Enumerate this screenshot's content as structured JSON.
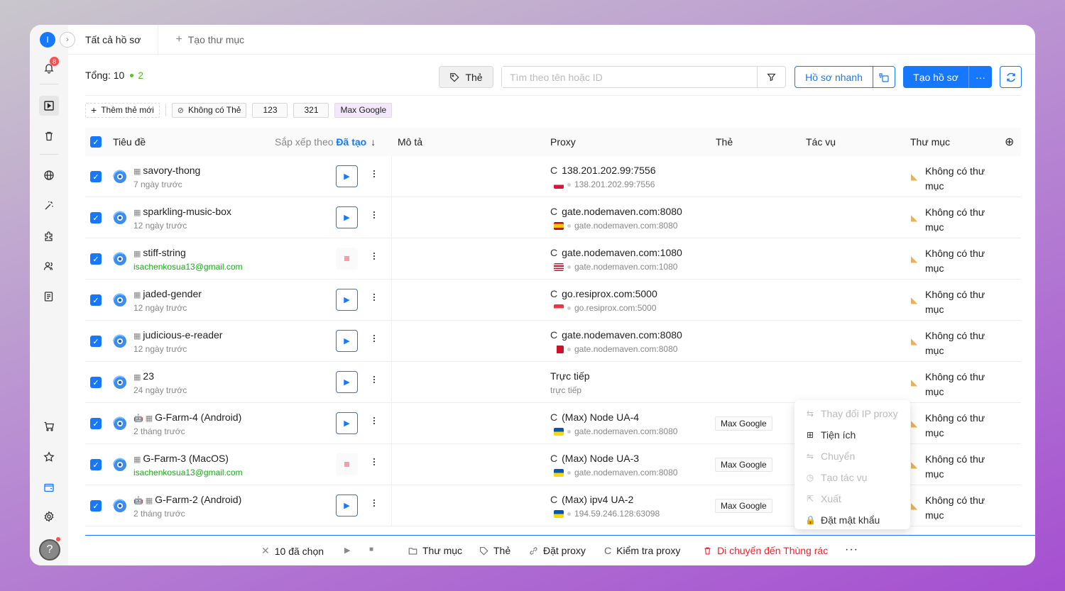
{
  "sidebar": {
    "avatar": "I",
    "expand_icon": "›",
    "notifications": "8"
  },
  "tabs": {
    "active": "Tất cả hồ sơ",
    "new_folder": "Tạo thư mục"
  },
  "toolbar": {
    "total_label": "Tổng:",
    "total": "10",
    "running": "2",
    "tag_button": "Thẻ",
    "search_placeholder": "Tìm theo tên hoặc ID",
    "quick_profile": "Hồ sơ nhanh",
    "create_profile": "Tạo hồ sơ",
    "more": "···"
  },
  "tags": {
    "add": "Thêm thẻ mới",
    "none": "Không có Thẻ",
    "items": [
      "123",
      "321",
      "Max Google"
    ]
  },
  "table": {
    "headers": {
      "title": "Tiêu đề",
      "sort_by": "Sắp xếp theo",
      "sort_field": "Đã tạo",
      "description": "Mô tả",
      "proxy": "Proxy",
      "tag": "Thẻ",
      "task": "Tác vụ",
      "folder": "Thư mục"
    },
    "rows": [
      {
        "name": "savory-thong",
        "sub": "7 ngày trước",
        "mail": false,
        "running": false,
        "proxy": "138.201.202.99:7556",
        "proxy_sub": "138.201.202.99:7556",
        "flag": "pl",
        "reload": true,
        "tag": "",
        "folder": "Không có thư mục"
      },
      {
        "name": "sparkling-music-box",
        "sub": "12 ngày trước",
        "mail": false,
        "running": false,
        "proxy": "gate.nodemaven.com:8080",
        "proxy_sub": "gate.nodemaven.com:8080",
        "flag": "es",
        "reload": true,
        "tag": "",
        "folder": "Không có thư mục"
      },
      {
        "name": "stiff-string",
        "sub": "isachenkosua13@gmail.com",
        "mail": true,
        "running": true,
        "proxy": "gate.nodemaven.com:1080",
        "proxy_sub": "gate.nodemaven.com:1080",
        "flag": "us",
        "reload": true,
        "tag": "",
        "folder": "Không có thư mục"
      },
      {
        "name": "jaded-gender",
        "sub": "12 ngày trước",
        "mail": false,
        "running": false,
        "proxy": "go.resiprox.com:5000",
        "proxy_sub": "go.resiprox.com:5000",
        "flag": "sg",
        "reload": true,
        "tag": "",
        "folder": "Không có thư mục"
      },
      {
        "name": "judicious-e-reader",
        "sub": "12 ngày trước",
        "mail": false,
        "running": false,
        "proxy": "gate.nodemaven.com:8080",
        "proxy_sub": "gate.nodemaven.com:8080",
        "flag": "bh",
        "reload": true,
        "tag": "",
        "folder": "Không có thư mục"
      },
      {
        "name": "23",
        "sub": "24 ngày trước",
        "mail": false,
        "running": false,
        "proxy": "Trực tiếp",
        "proxy_sub": "trực tiếp",
        "flag": "",
        "reload": false,
        "tag": "",
        "folder": "Không có thư mục"
      },
      {
        "name": "G-Farm-4 (Android)",
        "sub": "2 tháng trước",
        "mail": false,
        "running": false,
        "android": true,
        "proxy": "(Max) Node UA-4",
        "proxy_sub": "gate.nodemaven.com:8080",
        "flag": "ua",
        "reload": true,
        "tag": "Max Google",
        "folder": "Không có thư mục"
      },
      {
        "name": "G-Farm-3 (MacOS)",
        "sub": "isachenkosua13@gmail.com",
        "mail": true,
        "running": true,
        "android": false,
        "proxy": "(Max) Node UA-3",
        "proxy_sub": "gate.nodemaven.com:8080",
        "flag": "ua",
        "reload": true,
        "tag": "Max Google",
        "folder": "Không có thư mục"
      },
      {
        "name": "G-Farm-2 (Android)",
        "sub": "2 tháng trước",
        "mail": false,
        "running": false,
        "android": true,
        "proxy": "(Max) ipv4 UA-2",
        "proxy_sub": "194.59.246.128:63098",
        "flag": "ua",
        "reload": true,
        "tag": "Max Google",
        "folder": "Không có thư mục"
      }
    ]
  },
  "context_menu": [
    {
      "label": "Thay đổi IP proxy",
      "disabled": true,
      "icon": "change-ip-icon"
    },
    {
      "label": "Tiện ích",
      "disabled": false,
      "icon": "grid-icon"
    },
    {
      "label": "Chuyển",
      "disabled": true,
      "icon": "transfer-icon"
    },
    {
      "label": "Tạo tác vụ",
      "disabled": true,
      "icon": "clock-icon"
    },
    {
      "label": "Xuất",
      "disabled": true,
      "icon": "export-icon"
    },
    {
      "label": "Đặt mật khẩu",
      "disabled": false,
      "icon": "lock-icon"
    }
  ],
  "bottom_bar": {
    "selected": "10 đã chọn",
    "folder": "Thư mục",
    "tag": "Thẻ",
    "set_proxy": "Đặt proxy",
    "check_proxy": "Kiểm tra proxy",
    "trash": "Di chuyển đến Thùng rác",
    "more": "···"
  },
  "colors": {
    "accent": "#1677ff",
    "success": "#52c41a",
    "danger": "#f5222d"
  }
}
